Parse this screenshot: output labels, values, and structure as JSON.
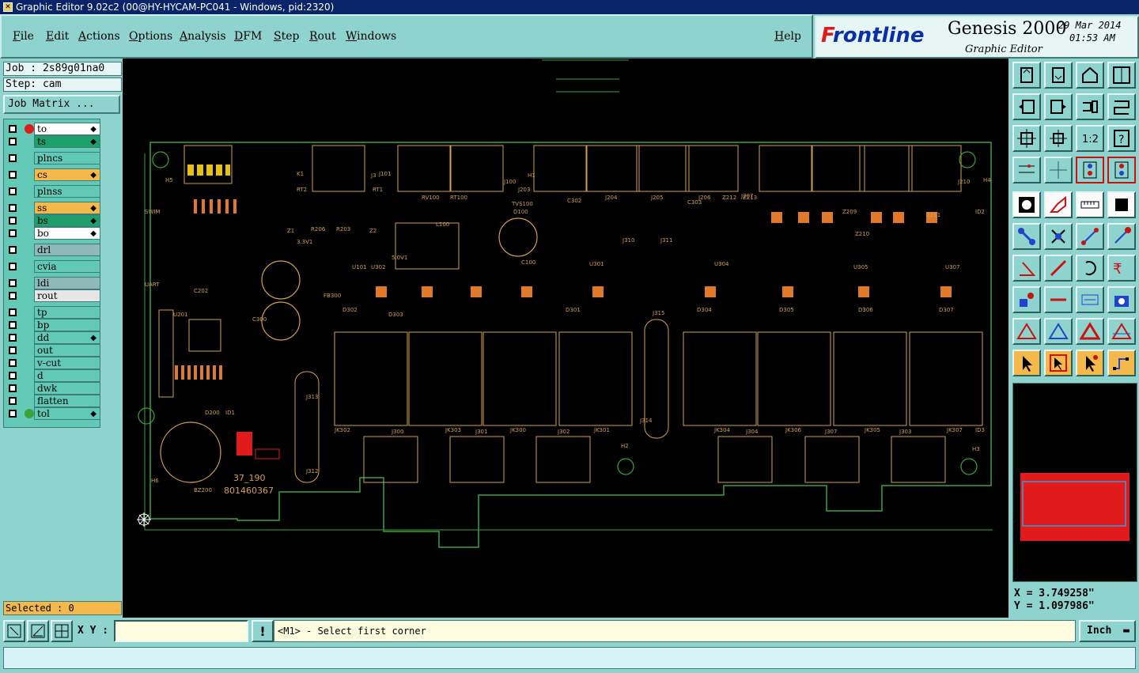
{
  "window": {
    "title": "Graphic Editor 9.02c2 (00@HY-HYCAM-PC041 - Windows, pid:2320)"
  },
  "menu": {
    "file": "File",
    "edit": "Edit",
    "actions": "Actions",
    "options": "Options",
    "analysis": "Analysis",
    "dfm": "DFM",
    "step": "Step",
    "rout": "Rout",
    "windows": "Windows",
    "help": "Help"
  },
  "brand": {
    "logo_prefix": "F",
    "logo_rest": "rontline",
    "product": "Genesis 2000",
    "subtitle": "Graphic Editor",
    "date": "29 Mar 2014",
    "time": "01:53 AM"
  },
  "job": {
    "job_line": "Job : 2s89g01na0",
    "step_line": "Step: cam",
    "matrix_button": "Job Matrix ..."
  },
  "layers": [
    {
      "name": "to",
      "color": "#ffffff",
      "dot": "#e11b1b",
      "affected": true
    },
    {
      "name": "ts",
      "color": "#1e9e6b",
      "dot": "",
      "affected": true
    },
    {
      "name": "plncs",
      "color": "#61c9b5",
      "dot": "",
      "affected": false
    },
    {
      "name": "cs",
      "color": "#f5b84a",
      "dot": "",
      "affected": true
    },
    {
      "name": "plnss",
      "color": "#61c9b5",
      "dot": "",
      "affected": false
    },
    {
      "name": "ss",
      "color": "#f5b84a",
      "dot": "",
      "affected": true
    },
    {
      "name": "bs",
      "color": "#1e9e6b",
      "dot": "",
      "affected": true
    },
    {
      "name": "bo",
      "color": "#ffffff",
      "dot": "",
      "affected": true
    },
    {
      "name": "drl",
      "color": "#8fb8b8",
      "dot": "",
      "affected": false
    },
    {
      "name": "cvia",
      "color": "#61c9b5",
      "dot": "",
      "affected": false
    },
    {
      "name": "ldi",
      "color": "#8fb8b8",
      "dot": "",
      "affected": false
    },
    {
      "name": "rout",
      "color": "#e6e6e6",
      "dot": "",
      "affected": false
    },
    {
      "name": "tp",
      "color": "#61c9b5",
      "dot": "",
      "affected": false
    },
    {
      "name": "bp",
      "color": "#61c9b5",
      "dot": "",
      "affected": false
    },
    {
      "name": "dd",
      "color": "#61c9b5",
      "dot": "",
      "affected": true
    },
    {
      "name": "out",
      "color": "#61c9b5",
      "dot": "",
      "affected": false
    },
    {
      "name": "v-cut",
      "color": "#61c9b5",
      "dot": "",
      "affected": false
    },
    {
      "name": "d",
      "color": "#61c9b5",
      "dot": "",
      "affected": false
    },
    {
      "name": "dwk",
      "color": "#61c9b5",
      "dot": "",
      "affected": false
    },
    {
      "name": "flatten",
      "color": "#61c9b5",
      "dot": "",
      "affected": false
    },
    {
      "name": "tol",
      "color": "#61c9b5",
      "dot": "#3aa33a",
      "affected": true
    }
  ],
  "selected": "Selected : 0",
  "coords": {
    "x": "X = 3.749258\"",
    "y": "Y = 1.097986\""
  },
  "statusbar": {
    "xy_label": "X Y :",
    "xy_value": "",
    "bang": "!",
    "prompt": "<M1> - Select first corner",
    "units": "Inch"
  },
  "board_labels": [
    "J101",
    "J3",
    "H1",
    "J100",
    "J203",
    "J204",
    "J205",
    "J206",
    "J207",
    "Z212",
    "Z213",
    "J210",
    "H4",
    "RV100",
    "RT100",
    "TVS100",
    "D100",
    "C302",
    "C303",
    "J310",
    "J311",
    "Z209",
    "ID2",
    "Z210",
    "Z211",
    "H5",
    "SWIM",
    "UART",
    "K1",
    "RT2",
    "RT1",
    "R206",
    "R203",
    "Z1",
    "Z2",
    "L100",
    "3.3V1",
    "5.0V1",
    "U101",
    "U302",
    "C100",
    "U301",
    "U304",
    "U305",
    "U307",
    "D302",
    "D303",
    "D301",
    "D304",
    "D305",
    "D306",
    "D307",
    "U201",
    "C202",
    "FB300",
    "C300",
    "J315",
    "J313",
    "J314",
    "J312",
    "D200",
    "ID1",
    "H6",
    "BZ200",
    "H2",
    "H3",
    "ID3",
    "JK302",
    "J300",
    "JK303",
    "J301",
    "JK300",
    "J302",
    "JK301",
    "JK304",
    "J304",
    "JK306",
    "J307",
    "JK305",
    "J303",
    "JK307",
    "37_190",
    "801460367"
  ],
  "tool_icons": [
    "zoom-home-icon",
    "zoom-fit-icon",
    "home-icon",
    "window-split-icon",
    "pan-left-icon",
    "pan-right-icon",
    "pan-snake-icon",
    "pan-return-icon",
    "zoom-in-icon",
    "zoom-out-icon",
    "scale-one-icon",
    "query-icon",
    "measure-icon",
    "grid-icon",
    "layer-compare-icon",
    "layer-compare-alt-icon",
    "snap-icon",
    "edit-shape-icon",
    "ruler-icon",
    "stop-icon",
    "connect-nodes-icon",
    "cross-move-icon",
    "line-node-icon",
    "arrow-node-icon",
    "angle-icon",
    "diagonal-icon",
    "arc-icon",
    "fit-arrows-icon",
    "pad-node-icon",
    "segment-icon",
    "range-icon",
    "camera-icon",
    "triangle-icon",
    "triangle-alt-icon",
    "triangle-filled-icon",
    "triangle-cut-icon",
    "select-arrow-icon",
    "select-box-icon",
    "select-net-icon",
    "route-icon"
  ],
  "colors": {
    "panel": "#8fd3cf",
    "canvas": "#000000",
    "board_outline": "#3aa33a",
    "component": "#d4a04a",
    "pad": "#e07a2a",
    "highlight": "#e11b1b"
  }
}
